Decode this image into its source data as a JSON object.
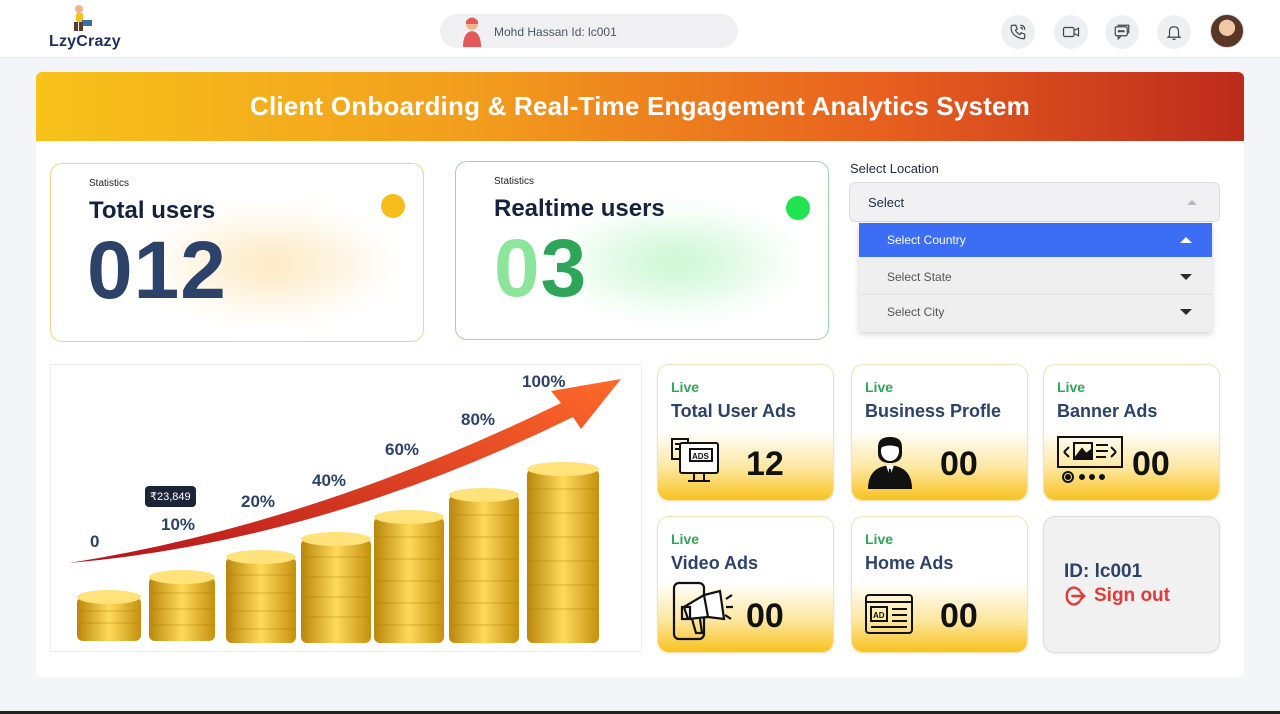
{
  "header": {
    "logo_text": "LzyCrazy",
    "user_label": "Mohd Hassan Id: lc001",
    "icons": [
      "phone-icon",
      "video-icon",
      "chat-icon",
      "bell-icon"
    ]
  },
  "banner": {
    "title": "Client Onboarding & Real-Time Engagement Analytics System"
  },
  "stats": {
    "total": {
      "small": "Statistics",
      "title": "Total users",
      "value": "012",
      "dot_color": "#f6bd1d"
    },
    "realtime": {
      "small": "Statistics",
      "title": "Realtime users",
      "value_a": "0",
      "value_b": "3",
      "dot_color": "#1fe44f"
    }
  },
  "location": {
    "label": "Select Location",
    "selected": "Select",
    "options": [
      "Select Country",
      "Select State",
      "Select City"
    ]
  },
  "growth": {
    "labels": [
      "0",
      "10%",
      "20%",
      "40%",
      "60%",
      "80%",
      "100%"
    ],
    "tooltip": "₹23,849"
  },
  "ads": [
    {
      "live": "Live",
      "title": "Total User Ads",
      "count": "12",
      "icon": "ads-monitor-icon"
    },
    {
      "live": "Live",
      "title": "Business Profle",
      "count": "00",
      "icon": "business-person-icon"
    },
    {
      "live": "Live",
      "title": "Banner Ads",
      "count": "00",
      "icon": "banner-icon"
    },
    {
      "live": "Live",
      "title": "Video Ads",
      "count": "00",
      "icon": "video-ads-icon"
    },
    {
      "live": "Live",
      "title": "Home Ads",
      "count": "00",
      "icon": "home-ads-icon"
    }
  ],
  "account": {
    "id_label": "ID: lc001",
    "signout_label": "Sign out"
  },
  "colors": {
    "accent_blue": "#3b6ef5",
    "brand_navy": "#2d4268",
    "live_green": "#2fa55a",
    "signout_red": "#e53838"
  }
}
